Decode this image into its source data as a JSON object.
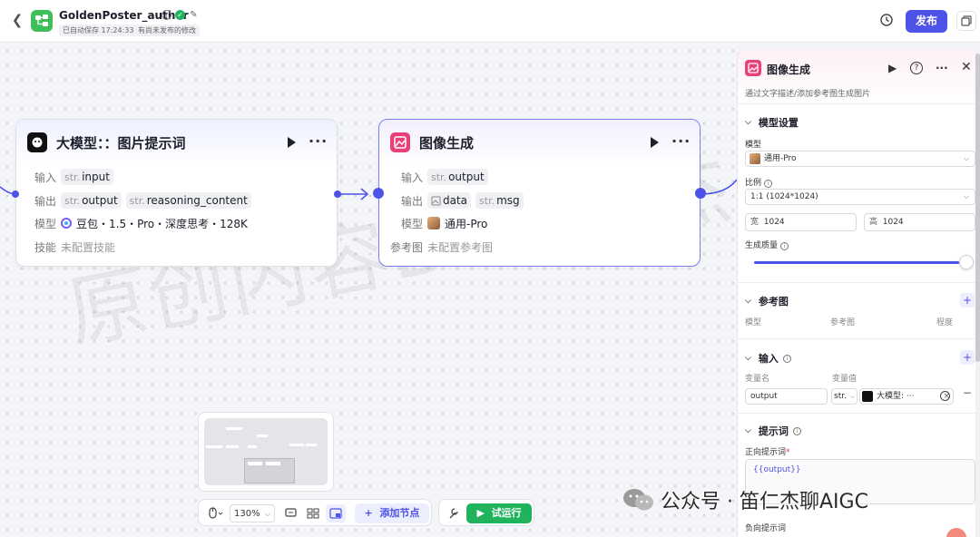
{
  "header": {
    "app_title": "GoldenPoster_author",
    "autosave": "已自动保存 17:24:33",
    "unpublished": "有尚未发布的修改",
    "publish_label": "发布"
  },
  "canvas": {
    "watermark": "原创内容BY笛仁杰",
    "node1": {
      "title": "大模型：：图片提示词",
      "input_label": "输入",
      "input_type": "str.",
      "input_name": "input",
      "output_label": "输出",
      "output1_type": "str.",
      "output1_name": "output",
      "output2_type": "str.",
      "output2_name": "reasoning_content",
      "model_label": "模型",
      "model_value": "豆包・1.5・Pro・深度思考・128K",
      "skill_label": "技能",
      "skill_value": "未配置技能"
    },
    "node2": {
      "title": "图像生成",
      "input_label": "输入",
      "input_type": "str.",
      "input_name": "output",
      "output_label": "输出",
      "output1_name": "data",
      "output2_type": "str.",
      "output2_name": "msg",
      "model_label": "模型",
      "model_value": "通用-Pro",
      "ref_label": "参考图",
      "ref_value": "未配置参考图"
    },
    "toolbar": {
      "zoom": "130%",
      "add_node": "添加节点",
      "test_run": "试运行"
    }
  },
  "panel": {
    "title": "图像生成",
    "description": "通过文字描述/添加参考图生成图片",
    "model_settings": "模型设置",
    "model_label": "模型",
    "model_value": "通用-Pro",
    "ratio_label": "比例",
    "ratio_value": "1:1 (1024*1024)",
    "width_label": "宽",
    "width_value": "1024",
    "height_label": "高",
    "height_value": "1024",
    "quality_label": "生成质量",
    "quality_level": 1.0,
    "ref_section": "参考图",
    "ref_col1": "模型",
    "ref_col2": "参考图",
    "ref_col3": "程度",
    "input_section": "输入",
    "var_name_label": "变量名",
    "var_value_label": "变量值",
    "var_name": "output",
    "var_type": "str.",
    "var_ref": "大模型: ···",
    "prompt_section": "提示词",
    "positive_label": "正向提示词",
    "positive_value": "{{output}}",
    "negative_label": "负向提示词"
  },
  "overlay": {
    "wechat_text": "公众号 · 笛仁杰聊AIGC"
  },
  "colors": {
    "primary": "#4d53e8",
    "run_green": "#20b35b",
    "image_node": "#e8417a",
    "app_icon": "#3fbe5a"
  }
}
